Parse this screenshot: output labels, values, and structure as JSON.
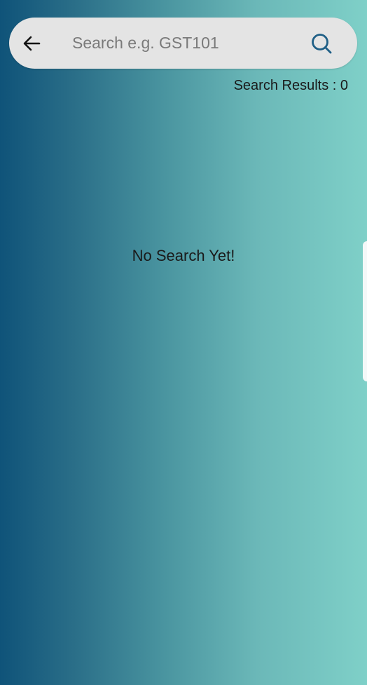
{
  "search": {
    "placeholder": "Search e.g. GST101",
    "value": ""
  },
  "icons": {
    "back": "arrow-left-icon",
    "search": "search-icon"
  },
  "results": {
    "label": "Search Results : 0"
  },
  "empty_state": {
    "message": "No Search Yet!"
  },
  "colors": {
    "gradient_start": "#0f5379",
    "gradient_end": "#7fd0c8",
    "search_bar_bg": "#e4e4e4",
    "search_icon": "#1f5f86",
    "text": "#1a1a1a"
  }
}
